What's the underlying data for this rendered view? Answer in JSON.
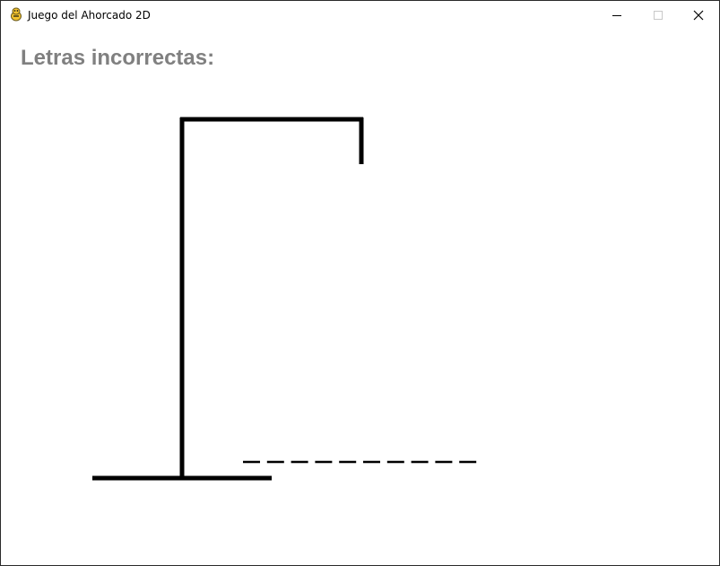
{
  "window": {
    "title": "Juego del Ahorcado 2D",
    "icon": "pygame-snake-icon",
    "controls": [
      "minimize-icon",
      "maximize-icon",
      "close-icon"
    ]
  },
  "game": {
    "wrong_letters_label": "Letras incorrectas:",
    "wrong_letters": "",
    "hidden_word_slots": 10,
    "errors_drawn": 0,
    "colors": {
      "background": "#ffffff",
      "label": "#808080",
      "lines": "#000000"
    }
  }
}
